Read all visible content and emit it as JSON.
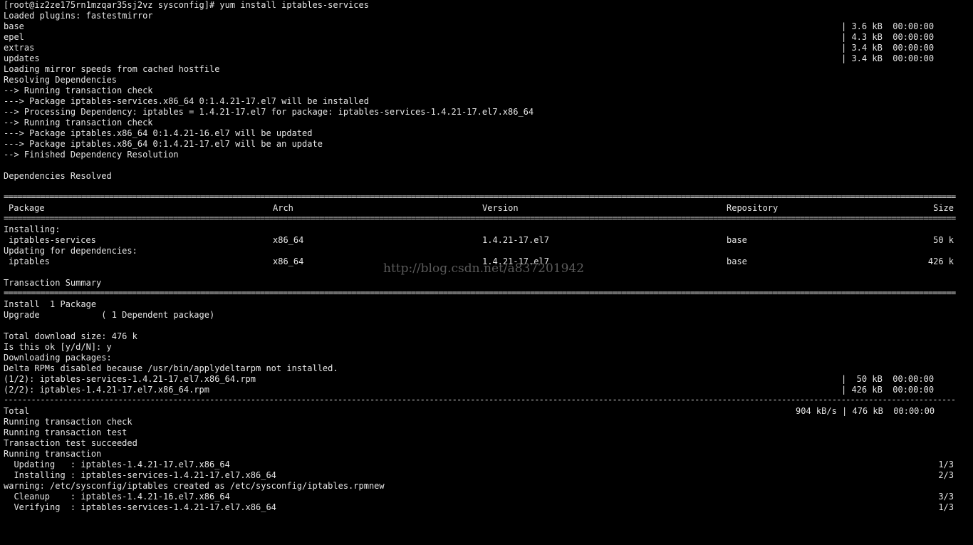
{
  "colors": {
    "background": "#000000",
    "text": "#e6e6e6",
    "watermark": "#5a5a5a"
  },
  "prompt_line": "[root@iz2ze175rn1mzqar35sj2vz sysconfig]# yum install iptables-services",
  "plugins_line": "Loaded plugins: fastestmirror",
  "repos": [
    {
      "name": "base",
      "size": "| 3.6 kB  00:00:00"
    },
    {
      "name": "epel",
      "size": "| 4.3 kB  00:00:00"
    },
    {
      "name": "extras",
      "size": "| 3.4 kB  00:00:00"
    },
    {
      "name": "updates",
      "size": "| 3.4 kB  00:00:00"
    }
  ],
  "resolve_lines": [
    "Loading mirror speeds from cached hostfile",
    "Resolving Dependencies",
    "--> Running transaction check",
    "---> Package iptables-services.x86_64 0:1.4.21-17.el7 will be installed",
    "--> Processing Dependency: iptables = 1.4.21-17.el7 for package: iptables-services-1.4.21-17.el7.x86_64",
    "--> Running transaction check",
    "---> Package iptables.x86_64 0:1.4.21-16.el7 will be updated",
    "---> Package iptables.x86_64 0:1.4.21-17.el7 will be an update",
    "--> Finished Dependency Resolution"
  ],
  "deps_resolved": "Dependencies Resolved",
  "table": {
    "headers": {
      "package": "Package",
      "arch": "Arch",
      "version": "Version",
      "repository": "Repository",
      "size": "Size"
    },
    "installing_label": "Installing:",
    "installing_row": {
      "package": "iptables-services",
      "arch": "x86_64",
      "version": "1.4.21-17.el7",
      "repository": "base",
      "size": "50 k"
    },
    "updating_label": "Updating for dependencies:",
    "updating_row": {
      "package": "iptables",
      "arch": "x86_64",
      "version": "1.4.21-17.el7",
      "repository": "base",
      "size": "426 k"
    }
  },
  "watermark": "http://blog.csdn.net/a837201942",
  "summary": {
    "title": "Transaction Summary",
    "install": "Install  1 Package",
    "upgrade": "Upgrade            ( 1 Dependent package)",
    "total_size": "Total download size: 476 k",
    "prompt": "Is this ok [y/d/N]: y",
    "downloading": "Downloading packages:",
    "delta": "Delta RPMs disabled because /usr/bin/applydeltarpm not installed."
  },
  "downloads": [
    {
      "name": "(1/2): iptables-services-1.4.21-17.el7.x86_64.rpm",
      "size": "|  50 kB  00:00:00"
    },
    {
      "name": "(2/2): iptables-1.4.21-17.el7.x86_64.rpm",
      "size": "| 426 kB  00:00:00"
    }
  ],
  "total": {
    "label": "Total",
    "rate": "904 kB/s | 476 kB  00:00:00"
  },
  "run_lines": [
    "Running transaction check",
    "Running transaction test",
    "Transaction test succeeded",
    "Running transaction"
  ],
  "steps": [
    {
      "text": "  Updating   : iptables-1.4.21-17.el7.x86_64",
      "count": "1/3"
    },
    {
      "text": "  Installing : iptables-services-1.4.21-17.el7.x86_64",
      "count": "2/3"
    },
    {
      "text": "warning: /etc/sysconfig/iptables created as /etc/sysconfig/iptables.rpmnew",
      "count": ""
    },
    {
      "text": "  Cleanup    : iptables-1.4.21-16.el7.x86_64",
      "count": "3/3"
    },
    {
      "text": "  Verifying  : iptables-services-1.4.21-17.el7.x86_64",
      "count": "1/3"
    }
  ]
}
